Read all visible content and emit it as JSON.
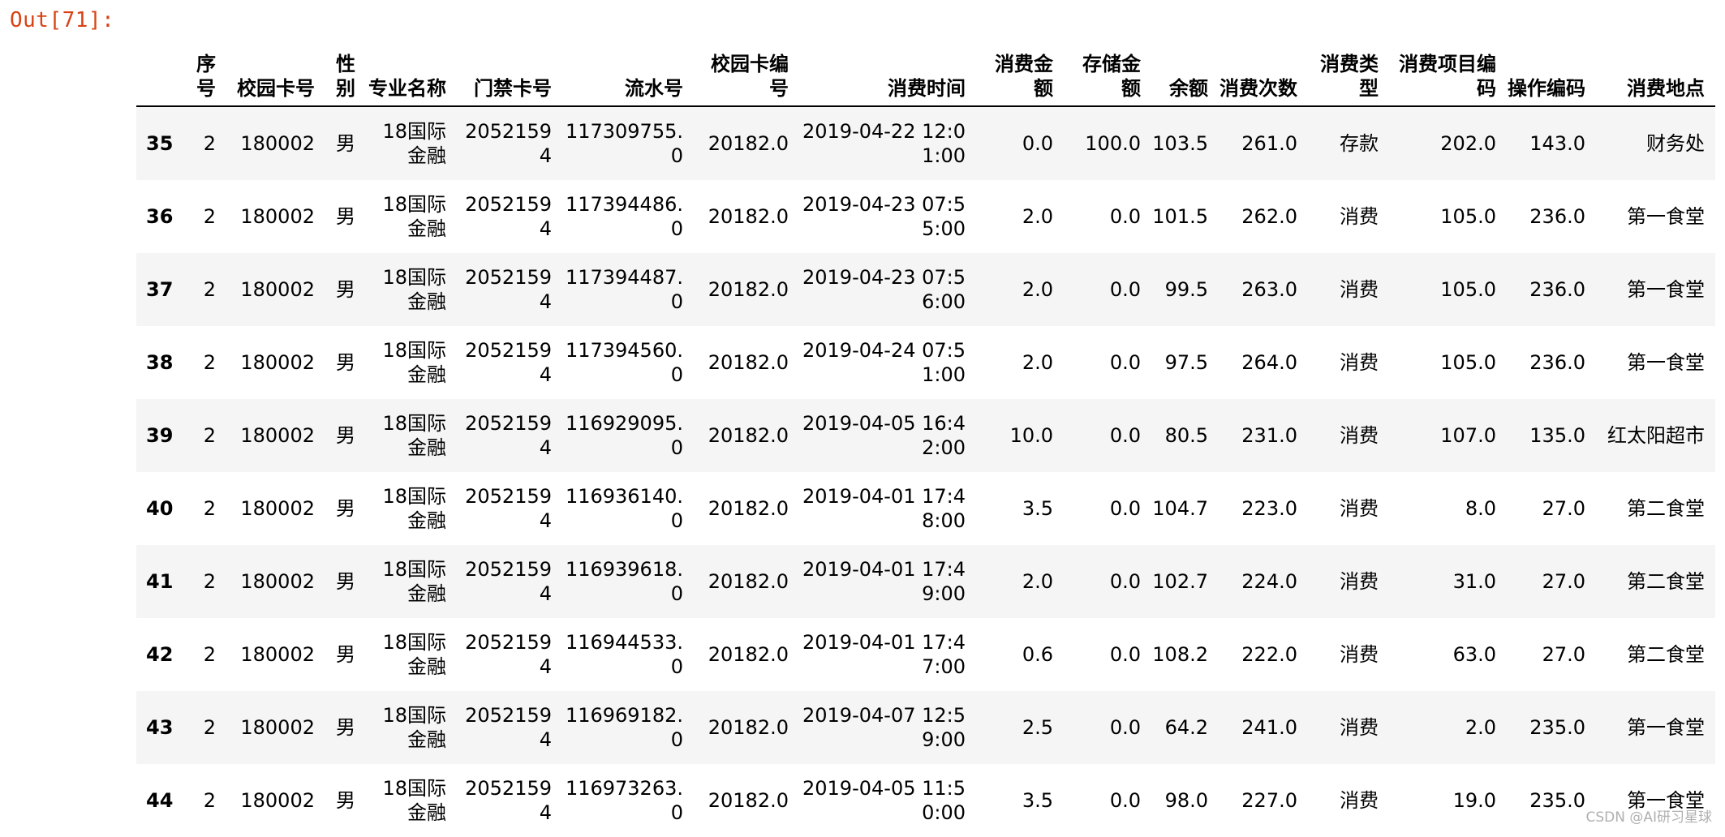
{
  "prompt": "Out[71]:",
  "watermark": "CSDN @AI研习星球",
  "columns": [
    "",
    "序号",
    "校园卡号",
    "性别",
    "专业名称",
    "门禁卡号",
    "流水号",
    "校园卡编号",
    "消费时间",
    "消费金额",
    "存储金额",
    "余额",
    "消费次数",
    "消费类型",
    "消费项目编码",
    "操作编码",
    "消费地点"
  ],
  "rows": [
    [
      "35",
      "2",
      "180002",
      "男",
      "18国际金融",
      "20521594",
      "117309755.0",
      "20182.0",
      "2019-04-22 12:01:00",
      "0.0",
      "100.0",
      "103.5",
      "261.0",
      "存款",
      "202.0",
      "143.0",
      "财务处"
    ],
    [
      "36",
      "2",
      "180002",
      "男",
      "18国际金融",
      "20521594",
      "117394486.0",
      "20182.0",
      "2019-04-23 07:55:00",
      "2.0",
      "0.0",
      "101.5",
      "262.0",
      "消费",
      "105.0",
      "236.0",
      "第一食堂"
    ],
    [
      "37",
      "2",
      "180002",
      "男",
      "18国际金融",
      "20521594",
      "117394487.0",
      "20182.0",
      "2019-04-23 07:56:00",
      "2.0",
      "0.0",
      "99.5",
      "263.0",
      "消费",
      "105.0",
      "236.0",
      "第一食堂"
    ],
    [
      "38",
      "2",
      "180002",
      "男",
      "18国际金融",
      "20521594",
      "117394560.0",
      "20182.0",
      "2019-04-24 07:51:00",
      "2.0",
      "0.0",
      "97.5",
      "264.0",
      "消费",
      "105.0",
      "236.0",
      "第一食堂"
    ],
    [
      "39",
      "2",
      "180002",
      "男",
      "18国际金融",
      "20521594",
      "116929095.0",
      "20182.0",
      "2019-04-05 16:42:00",
      "10.0",
      "0.0",
      "80.5",
      "231.0",
      "消费",
      "107.0",
      "135.0",
      "红太阳超市"
    ],
    [
      "40",
      "2",
      "180002",
      "男",
      "18国际金融",
      "20521594",
      "116936140.0",
      "20182.0",
      "2019-04-01 17:48:00",
      "3.5",
      "0.0",
      "104.7",
      "223.0",
      "消费",
      "8.0",
      "27.0",
      "第二食堂"
    ],
    [
      "41",
      "2",
      "180002",
      "男",
      "18国际金融",
      "20521594",
      "116939618.0",
      "20182.0",
      "2019-04-01 17:49:00",
      "2.0",
      "0.0",
      "102.7",
      "224.0",
      "消费",
      "31.0",
      "27.0",
      "第二食堂"
    ],
    [
      "42",
      "2",
      "180002",
      "男",
      "18国际金融",
      "20521594",
      "116944533.0",
      "20182.0",
      "2019-04-01 17:47:00",
      "0.6",
      "0.0",
      "108.2",
      "222.0",
      "消费",
      "63.0",
      "27.0",
      "第二食堂"
    ],
    [
      "43",
      "2",
      "180002",
      "男",
      "18国际金融",
      "20521594",
      "116969182.0",
      "20182.0",
      "2019-04-07 12:59:00",
      "2.5",
      "0.0",
      "64.2",
      "241.0",
      "消费",
      "2.0",
      "235.0",
      "第一食堂"
    ],
    [
      "44",
      "2",
      "180002",
      "男",
      "18国际金融",
      "20521594",
      "116973263.0",
      "20182.0",
      "2019-04-05 11:50:00",
      "3.5",
      "0.0",
      "98.0",
      "227.0",
      "消费",
      "19.0",
      "235.0",
      "第一食堂"
    ]
  ],
  "colors": {
    "prompt": "#d84315",
    "stripe": "#f5f5f5",
    "header_rule": "#000000"
  }
}
